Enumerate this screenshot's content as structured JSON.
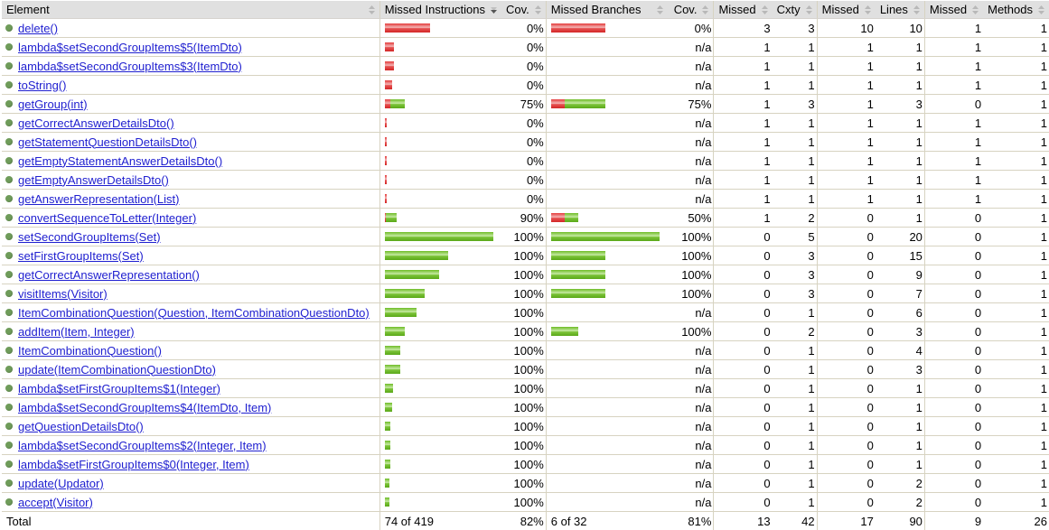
{
  "headers": [
    {
      "label": "Element",
      "sort": "both"
    },
    {
      "label": "Missed Instructions",
      "sort": "down"
    },
    {
      "label": "Cov.",
      "sort": "both"
    },
    {
      "label": "Missed Branches",
      "sort": "both"
    },
    {
      "label": "Cov.",
      "sort": "both"
    },
    {
      "label": "Missed",
      "sort": "both"
    },
    {
      "label": "Cxty",
      "sort": "both"
    },
    {
      "label": "Missed",
      "sort": "both"
    },
    {
      "label": "Lines",
      "sort": "both"
    },
    {
      "label": "Missed",
      "sort": "both"
    },
    {
      "label": "Methods",
      "sort": "both"
    }
  ],
  "colors": {
    "missed": "#d32626",
    "covered": "#6ebc26",
    "link": "#2020d0",
    "header_bg": "#e0e0e0"
  },
  "rows": [
    {
      "name": "delete()",
      "instr_missed": 1.0,
      "instr_scale": 0.417,
      "instr_cov": "0%",
      "br_missed": 1.0,
      "br_scale": 0.5,
      "br_cov": "0%",
      "cxty_missed": "3",
      "cxty": "3",
      "lines_missed": "10",
      "lines": "10",
      "methods_missed": "1",
      "methods": "1"
    },
    {
      "name": "lambda$setSecondGroupItems$5(ItemDto)",
      "instr_missed": 1.0,
      "instr_scale": 0.083,
      "instr_cov": "0%",
      "br_missed": null,
      "br_scale": 0,
      "br_cov": "n/a",
      "cxty_missed": "1",
      "cxty": "1",
      "lines_missed": "1",
      "lines": "1",
      "methods_missed": "1",
      "methods": "1"
    },
    {
      "name": "lambda$setSecondGroupItems$3(ItemDto)",
      "instr_missed": 1.0,
      "instr_scale": 0.083,
      "instr_cov": "0%",
      "br_missed": null,
      "br_scale": 0,
      "br_cov": "n/a",
      "cxty_missed": "1",
      "cxty": "1",
      "lines_missed": "1",
      "lines": "1",
      "methods_missed": "1",
      "methods": "1"
    },
    {
      "name": "toString()",
      "instr_missed": 1.0,
      "instr_scale": 0.067,
      "instr_cov": "0%",
      "br_missed": null,
      "br_scale": 0,
      "br_cov": "n/a",
      "cxty_missed": "1",
      "cxty": "1",
      "lines_missed": "1",
      "lines": "1",
      "methods_missed": "1",
      "methods": "1"
    },
    {
      "name": "getGroup(int)",
      "instr_missed": 0.25,
      "instr_scale": 0.183,
      "instr_cov": "75%",
      "br_missed": 0.25,
      "br_scale": 0.5,
      "br_cov": "75%",
      "cxty_missed": "1",
      "cxty": "3",
      "lines_missed": "1",
      "lines": "3",
      "methods_missed": "0",
      "methods": "1"
    },
    {
      "name": "getCorrectAnswerDetailsDto()",
      "instr_missed": 1.0,
      "instr_scale": 0.017,
      "instr_cov": "0%",
      "br_missed": null,
      "br_scale": 0,
      "br_cov": "n/a",
      "cxty_missed": "1",
      "cxty": "1",
      "lines_missed": "1",
      "lines": "1",
      "methods_missed": "1",
      "methods": "1"
    },
    {
      "name": "getStatementQuestionDetailsDto()",
      "instr_missed": 1.0,
      "instr_scale": 0.017,
      "instr_cov": "0%",
      "br_missed": null,
      "br_scale": 0,
      "br_cov": "n/a",
      "cxty_missed": "1",
      "cxty": "1",
      "lines_missed": "1",
      "lines": "1",
      "methods_missed": "1",
      "methods": "1"
    },
    {
      "name": "getEmptyStatementAnswerDetailsDto()",
      "instr_missed": 1.0,
      "instr_scale": 0.017,
      "instr_cov": "0%",
      "br_missed": null,
      "br_scale": 0,
      "br_cov": "n/a",
      "cxty_missed": "1",
      "cxty": "1",
      "lines_missed": "1",
      "lines": "1",
      "methods_missed": "1",
      "methods": "1"
    },
    {
      "name": "getEmptyAnswerDetailsDto()",
      "instr_missed": 1.0,
      "instr_scale": 0.017,
      "instr_cov": "0%",
      "br_missed": null,
      "br_scale": 0,
      "br_cov": "n/a",
      "cxty_missed": "1",
      "cxty": "1",
      "lines_missed": "1",
      "lines": "1",
      "methods_missed": "1",
      "methods": "1"
    },
    {
      "name": "getAnswerRepresentation(List)",
      "instr_missed": 1.0,
      "instr_scale": 0.017,
      "instr_cov": "0%",
      "br_missed": null,
      "br_scale": 0,
      "br_cov": "n/a",
      "cxty_missed": "1",
      "cxty": "1",
      "lines_missed": "1",
      "lines": "1",
      "methods_missed": "1",
      "methods": "1"
    },
    {
      "name": "convertSequenceToLetter(Integer)",
      "instr_missed": 0.1,
      "instr_scale": 0.108,
      "instr_cov": "90%",
      "br_missed": 0.5,
      "br_scale": 0.25,
      "br_cov": "50%",
      "cxty_missed": "1",
      "cxty": "2",
      "lines_missed": "0",
      "lines": "1",
      "methods_missed": "0",
      "methods": "1"
    },
    {
      "name": "setSecondGroupItems(Set)",
      "instr_missed": 0.0,
      "instr_scale": 1.0,
      "instr_cov": "100%",
      "br_missed": 0.0,
      "br_scale": 1.0,
      "br_cov": "100%",
      "cxty_missed": "0",
      "cxty": "5",
      "lines_missed": "0",
      "lines": "20",
      "methods_missed": "0",
      "methods": "1"
    },
    {
      "name": "setFirstGroupItems(Set)",
      "instr_missed": 0.0,
      "instr_scale": 0.583,
      "instr_cov": "100%",
      "br_missed": 0.0,
      "br_scale": 0.5,
      "br_cov": "100%",
      "cxty_missed": "0",
      "cxty": "3",
      "lines_missed": "0",
      "lines": "15",
      "methods_missed": "0",
      "methods": "1"
    },
    {
      "name": "getCorrectAnswerRepresentation()",
      "instr_missed": 0.0,
      "instr_scale": 0.5,
      "instr_cov": "100%",
      "br_missed": 0.0,
      "br_scale": 0.5,
      "br_cov": "100%",
      "cxty_missed": "0",
      "cxty": "3",
      "lines_missed": "0",
      "lines": "9",
      "methods_missed": "0",
      "methods": "1"
    },
    {
      "name": "visitItems(Visitor)",
      "instr_missed": 0.0,
      "instr_scale": 0.367,
      "instr_cov": "100%",
      "br_missed": 0.0,
      "br_scale": 0.5,
      "br_cov": "100%",
      "cxty_missed": "0",
      "cxty": "3",
      "lines_missed": "0",
      "lines": "7",
      "methods_missed": "0",
      "methods": "1"
    },
    {
      "name": "ItemCombinationQuestion(Question, ItemCombinationQuestionDto)",
      "instr_missed": 0.0,
      "instr_scale": 0.292,
      "instr_cov": "100%",
      "br_missed": null,
      "br_scale": 0,
      "br_cov": "n/a",
      "cxty_missed": "0",
      "cxty": "1",
      "lines_missed": "0",
      "lines": "6",
      "methods_missed": "0",
      "methods": "1"
    },
    {
      "name": "addItem(Item, Integer)",
      "instr_missed": 0.0,
      "instr_scale": 0.183,
      "instr_cov": "100%",
      "br_missed": 0.0,
      "br_scale": 0.25,
      "br_cov": "100%",
      "cxty_missed": "0",
      "cxty": "2",
      "lines_missed": "0",
      "lines": "3",
      "methods_missed": "0",
      "methods": "1"
    },
    {
      "name": "ItemCombinationQuestion()",
      "instr_missed": 0.0,
      "instr_scale": 0.142,
      "instr_cov": "100%",
      "br_missed": null,
      "br_scale": 0,
      "br_cov": "n/a",
      "cxty_missed": "0",
      "cxty": "1",
      "lines_missed": "0",
      "lines": "4",
      "methods_missed": "0",
      "methods": "1"
    },
    {
      "name": "update(ItemCombinationQuestionDto)",
      "instr_missed": 0.0,
      "instr_scale": 0.142,
      "instr_cov": "100%",
      "br_missed": null,
      "br_scale": 0,
      "br_cov": "n/a",
      "cxty_missed": "0",
      "cxty": "1",
      "lines_missed": "0",
      "lines": "3",
      "methods_missed": "0",
      "methods": "1"
    },
    {
      "name": "lambda$setFirstGroupItems$1(Integer)",
      "instr_missed": 0.0,
      "instr_scale": 0.075,
      "instr_cov": "100%",
      "br_missed": null,
      "br_scale": 0,
      "br_cov": "n/a",
      "cxty_missed": "0",
      "cxty": "1",
      "lines_missed": "0",
      "lines": "1",
      "methods_missed": "0",
      "methods": "1"
    },
    {
      "name": "lambda$setSecondGroupItems$4(ItemDto, Item)",
      "instr_missed": 0.0,
      "instr_scale": 0.067,
      "instr_cov": "100%",
      "br_missed": null,
      "br_scale": 0,
      "br_cov": "n/a",
      "cxty_missed": "0",
      "cxty": "1",
      "lines_missed": "0",
      "lines": "1",
      "methods_missed": "0",
      "methods": "1"
    },
    {
      "name": "getQuestionDetailsDto()",
      "instr_missed": 0.0,
      "instr_scale": 0.05,
      "instr_cov": "100%",
      "br_missed": null,
      "br_scale": 0,
      "br_cov": "n/a",
      "cxty_missed": "0",
      "cxty": "1",
      "lines_missed": "0",
      "lines": "1",
      "methods_missed": "0",
      "methods": "1"
    },
    {
      "name": "lambda$setSecondGroupItems$2(Integer, Item)",
      "instr_missed": 0.0,
      "instr_scale": 0.05,
      "instr_cov": "100%",
      "br_missed": null,
      "br_scale": 0,
      "br_cov": "n/a",
      "cxty_missed": "0",
      "cxty": "1",
      "lines_missed": "0",
      "lines": "1",
      "methods_missed": "0",
      "methods": "1"
    },
    {
      "name": "lambda$setFirstGroupItems$0(Integer, Item)",
      "instr_missed": 0.0,
      "instr_scale": 0.05,
      "instr_cov": "100%",
      "br_missed": null,
      "br_scale": 0,
      "br_cov": "n/a",
      "cxty_missed": "0",
      "cxty": "1",
      "lines_missed": "0",
      "lines": "1",
      "methods_missed": "0",
      "methods": "1"
    },
    {
      "name": "update(Updator)",
      "instr_missed": 0.0,
      "instr_scale": 0.042,
      "instr_cov": "100%",
      "br_missed": null,
      "br_scale": 0,
      "br_cov": "n/a",
      "cxty_missed": "0",
      "cxty": "1",
      "lines_missed": "0",
      "lines": "2",
      "methods_missed": "0",
      "methods": "1"
    },
    {
      "name": "accept(Visitor)",
      "instr_missed": 0.0,
      "instr_scale": 0.042,
      "instr_cov": "100%",
      "br_missed": null,
      "br_scale": 0,
      "br_cov": "n/a",
      "cxty_missed": "0",
      "cxty": "1",
      "lines_missed": "0",
      "lines": "2",
      "methods_missed": "0",
      "methods": "1"
    }
  ],
  "total": {
    "label": "Total",
    "instr": "74 of 419",
    "instr_cov": "82%",
    "br": "6 of 32",
    "br_cov": "81%",
    "cxty_missed": "13",
    "cxty": "42",
    "lines_missed": "17",
    "lines": "90",
    "methods_missed": "9",
    "methods": "26"
  }
}
